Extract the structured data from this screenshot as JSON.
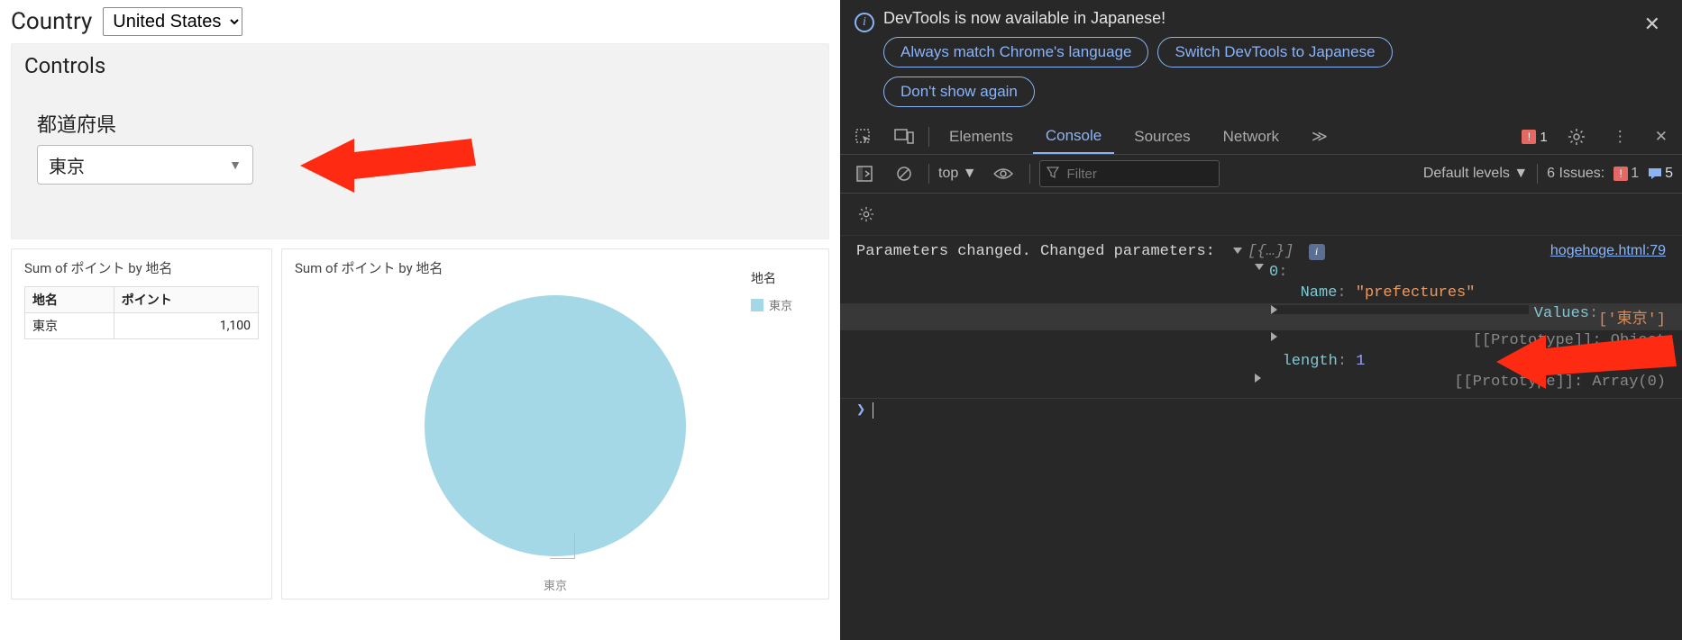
{
  "left": {
    "country_label": "Country",
    "country_value": "United States",
    "controls_title": "Controls",
    "control_label": "都道府県",
    "control_value": "東京",
    "viz_title": "Sum of ポイント by 地名",
    "table": {
      "headers": [
        "地名",
        "ポイント"
      ],
      "rows": [
        [
          "東京",
          "1,100"
        ]
      ]
    },
    "legend_title": "地名",
    "legend_item": "東京",
    "pie_caption": "東京"
  },
  "devtools": {
    "info_banner": "DevTools is now available in Japanese!",
    "pills": {
      "always": "Always match Chrome's language",
      "switch": "Switch DevTools to Japanese",
      "dont": "Don't show again"
    },
    "tabs": {
      "elements": "Elements",
      "console": "Console",
      "sources": "Sources",
      "network": "Network",
      "more": "≫"
    },
    "error_count": "1",
    "toolbar": {
      "top": "top",
      "filter_placeholder": "Filter",
      "levels": "Default levels",
      "issues_label": "6 Issues:",
      "issues_err": "1",
      "issues_msg": "5"
    },
    "console": {
      "msg": "Parameters changed. Changed parameters: ",
      "array_summary": "[{…}]",
      "source_link": "hogehoge.html:79",
      "lines": {
        "idx0": "0",
        "name_key": "Name",
        "name_val": "\"prefectures\"",
        "values_key": "Values",
        "values_val": "['東京']",
        "proto_obj": "[[Prototype]]: Object",
        "length_key": "length",
        "length_val": "1",
        "proto_arr": "[[Prototype]]: Array(0)"
      }
    }
  },
  "chart_data": {
    "type": "pie",
    "title": "Sum of ポイント by 地名",
    "categories": [
      "東京"
    ],
    "values": [
      1100
    ],
    "series": [
      {
        "name": "東京",
        "value": 1100,
        "color": "#a4d8e6"
      }
    ],
    "legend_title": "地名"
  }
}
